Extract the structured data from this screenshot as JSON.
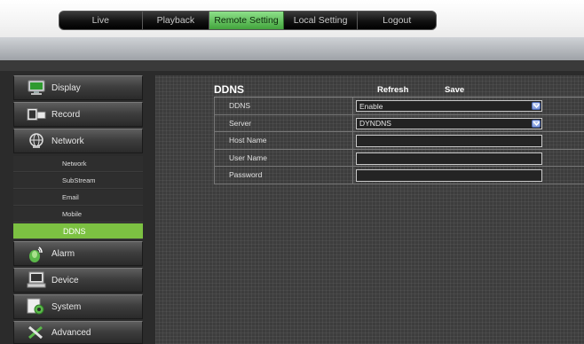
{
  "nav": {
    "tabs": [
      {
        "label": "Live",
        "active": false
      },
      {
        "label": "Playback",
        "active": false
      },
      {
        "label": "Remote Setting",
        "active": true
      },
      {
        "label": "Local Setting",
        "active": false
      },
      {
        "label": "Logout",
        "active": false
      }
    ]
  },
  "sidebar": {
    "display": {
      "label": "Display",
      "icon": "monitor-icon"
    },
    "record": {
      "label": "Record",
      "icon": "camera-icon"
    },
    "network": {
      "label": "Network",
      "icon": "globe-icon"
    },
    "subitems": [
      {
        "label": "Network"
      },
      {
        "label": "SubStream"
      },
      {
        "label": "Email"
      },
      {
        "label": "Mobile"
      },
      {
        "label": "DDNS",
        "active": true
      }
    ],
    "alarm": {
      "label": "Alarm",
      "icon": "alarm-icon"
    },
    "device": {
      "label": "Device",
      "icon": "device-icon"
    },
    "system": {
      "label": "System",
      "icon": "gear-icon"
    },
    "advanced": {
      "label": "Advanced",
      "icon": "tools-icon"
    }
  },
  "panel": {
    "title": "DDNS",
    "refresh_label": "Refresh",
    "save_label": "Save",
    "fields": {
      "ddns": {
        "label": "DDNS",
        "value": "Enable"
      },
      "server": {
        "label": "Server",
        "value": "DYNDNS"
      },
      "host_name": {
        "label": "Host Name",
        "value": ""
      },
      "user_name": {
        "label": "User Name",
        "value": ""
      },
      "password": {
        "label": "Password",
        "value": ""
      }
    }
  },
  "colors": {
    "accent_green": "#7cc142",
    "tab_active": "#5cb655"
  }
}
